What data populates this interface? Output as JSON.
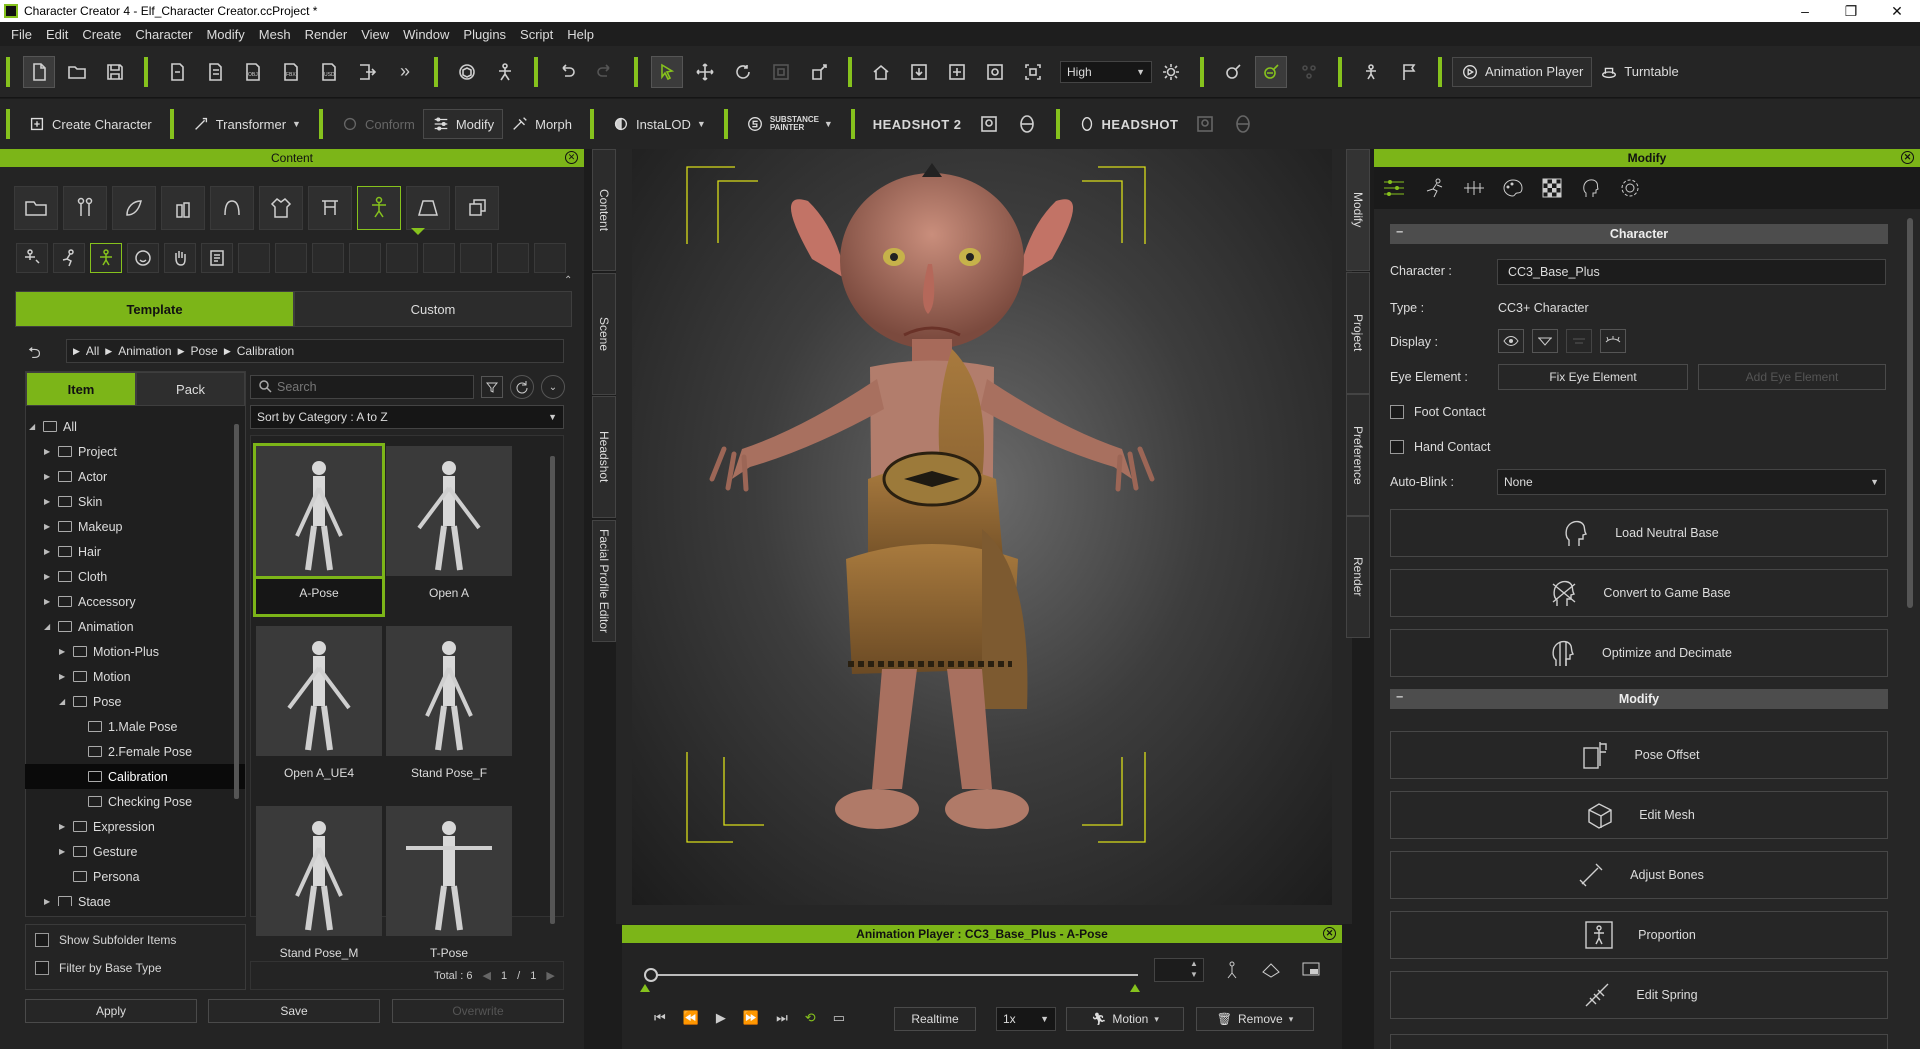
{
  "window": {
    "title": "Character Creator 4 - Elf_Character Creator.ccProject *"
  },
  "menu": [
    "File",
    "Edit",
    "Create",
    "Character",
    "Modify",
    "Mesh",
    "Render",
    "View",
    "Window",
    "Plugins",
    "Script",
    "Help"
  ],
  "toolbar": {
    "quality": "High",
    "animation_player": "Animation Player",
    "turntable": "Turntable"
  },
  "toolbar2": {
    "create_character": "Create Character",
    "transformer": "Transformer",
    "conform": "Conform",
    "modify": "Modify",
    "morph": "Morph",
    "instalod": "InstaLOD",
    "substance": "SUBSTANCE PAINTER",
    "headshot2": "HEADSHOT 2",
    "headshot": "HEADSHOT"
  },
  "content": {
    "title": "Content",
    "tabs": [
      "Template",
      "Custom"
    ],
    "breadcrumb": [
      "All",
      "Animation",
      "Pose",
      "Calibration"
    ],
    "subtabs": [
      "Item",
      "Pack"
    ],
    "search_placeholder": "Search",
    "sort": "Sort by Category : A to Z",
    "tree": [
      {
        "label": "All",
        "indent": 0,
        "arrow": "◢"
      },
      {
        "label": "Project",
        "indent": 1,
        "arrow": "▶"
      },
      {
        "label": "Actor",
        "indent": 1,
        "arrow": "▶"
      },
      {
        "label": "Skin",
        "indent": 1,
        "arrow": "▶"
      },
      {
        "label": "Makeup",
        "indent": 1,
        "arrow": "▶"
      },
      {
        "label": "Hair",
        "indent": 1,
        "arrow": "▶"
      },
      {
        "label": "Cloth",
        "indent": 1,
        "arrow": "▶"
      },
      {
        "label": "Accessory",
        "indent": 1,
        "arrow": "▶"
      },
      {
        "label": "Animation",
        "indent": 1,
        "arrow": "◢"
      },
      {
        "label": "Motion-Plus",
        "indent": 2,
        "arrow": "▶"
      },
      {
        "label": "Motion",
        "indent": 2,
        "arrow": "▶"
      },
      {
        "label": "Pose",
        "indent": 2,
        "arrow": "◢"
      },
      {
        "label": "1.Male Pose",
        "indent": 3,
        "arrow": ""
      },
      {
        "label": "2.Female Pose",
        "indent": 3,
        "arrow": ""
      },
      {
        "label": "Calibration",
        "indent": 3,
        "arrow": "",
        "selected": true
      },
      {
        "label": "Checking Pose",
        "indent": 3,
        "arrow": ""
      },
      {
        "label": "Expression",
        "indent": 2,
        "arrow": "▶"
      },
      {
        "label": "Gesture",
        "indent": 2,
        "arrow": "▶"
      },
      {
        "label": "Persona",
        "indent": 2,
        "arrow": ""
      },
      {
        "label": "Stage",
        "indent": 1,
        "arrow": "▶"
      }
    ],
    "items": [
      "A-Pose",
      "Open A",
      "Open A_UE4",
      "Stand Pose_F",
      "Stand Pose_M",
      "T-Pose"
    ],
    "show_subfolder": "Show Subfolder Items",
    "filter_base": "Filter by Base Type",
    "total": "Total : 6",
    "page": "1",
    "pages": "1",
    "apply": "Apply",
    "save": "Save",
    "overwrite": "Overwrite"
  },
  "vtabs_left": [
    "Content",
    "Scene",
    "Headshot",
    "Facial Profile Editor"
  ],
  "vtabs_right": [
    "Modify",
    "Project",
    "Preference",
    "Render"
  ],
  "animation_player": {
    "title": "Animation Player : CC3_Base_Plus - A-Pose",
    "frame": "",
    "realtime": "Realtime",
    "speed": "1x",
    "motion": "Motion",
    "remove": "Remove"
  },
  "modify": {
    "title": "Modify",
    "section_character": "Character",
    "character_label": "Character :",
    "character_value": "CC3_Base_Plus",
    "type_label": "Type :",
    "type_value": "CC3+ Character",
    "display_label": "Display :",
    "eye_label": "Eye Element :",
    "fix_eye": "Fix Eye Element",
    "add_eye": "Add Eye Element",
    "foot_contact": "Foot Contact",
    "hand_contact": "Hand Contact",
    "autoblink_label": "Auto-Blink :",
    "autoblink_value": "None",
    "buttons1": [
      "Load Neutral Base",
      "Convert to Game Base",
      "Optimize and Decimate"
    ],
    "section_modify": "Modify",
    "buttons2": [
      "Pose Offset",
      "Edit Mesh",
      "Adjust Bones",
      "Proportion",
      "Edit Spring"
    ]
  },
  "colors": {
    "accent": "#7cb518",
    "panel": "#242424",
    "viewport_center": "#6a6a6a"
  }
}
